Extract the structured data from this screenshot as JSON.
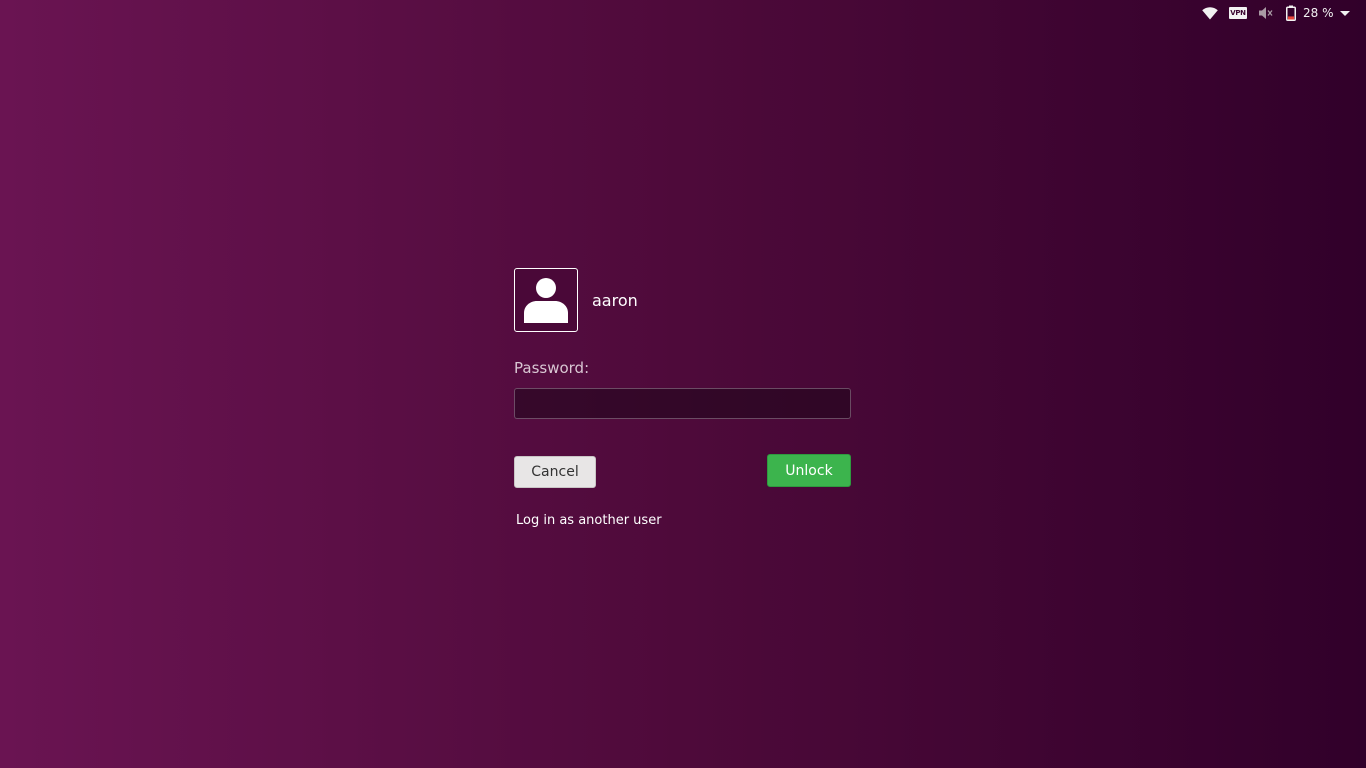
{
  "top_panel": {
    "icons": [
      "wifi-icon",
      "vpn-icon",
      "sound-muted-icon",
      "battery-icon"
    ],
    "vpn_label": "VPN",
    "battery_percent": "28 %",
    "battery_level": 0.28,
    "battery_color": "#e8463a"
  },
  "login": {
    "avatar_icon": "user-icon",
    "username": "aaron",
    "password_label": "Password:",
    "password_value": "",
    "cancel_label": "Cancel",
    "unlock_label": "Unlock",
    "another_user_label": "Log in as another user"
  },
  "colors": {
    "background_start": "#6a1452",
    "background_end": "#31002a",
    "unlock_green": "#3cb44d"
  }
}
